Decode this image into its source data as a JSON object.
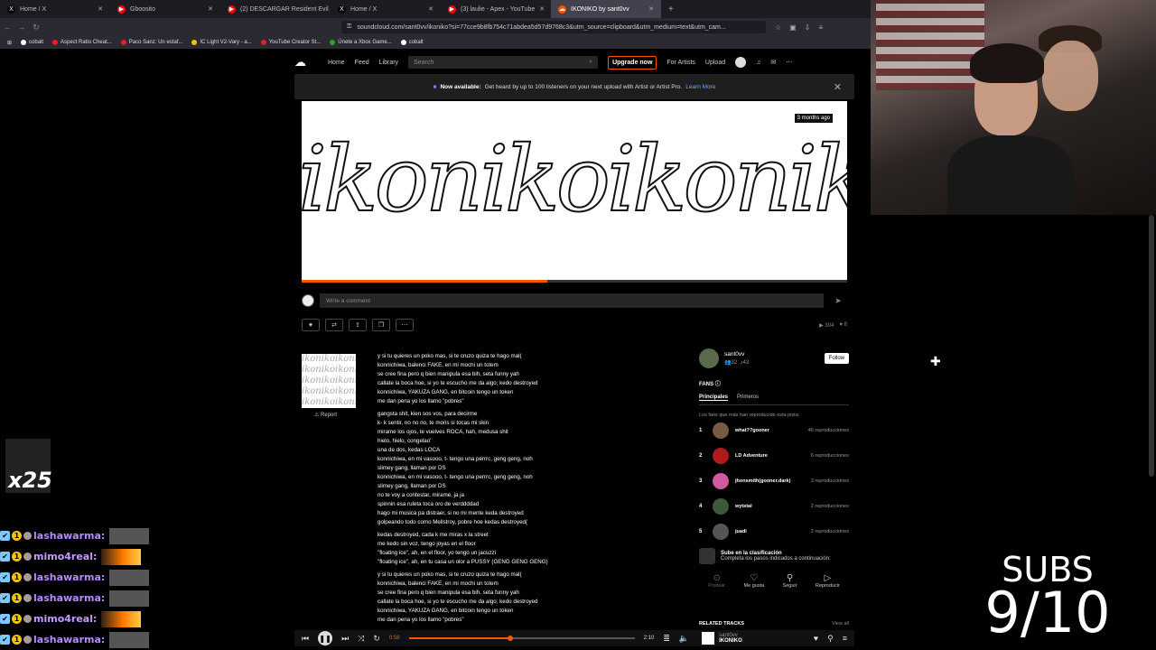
{
  "browser": {
    "tabs": [
      {
        "title": "Home / X",
        "icon": "x-icon",
        "color": "#000000",
        "active": false
      },
      {
        "title": "Gboosito",
        "icon": "youtube-icon",
        "color": "#ff0000",
        "active": false
      },
      {
        "title": "(2) DESCARGAR Resident Evil 4 Ultim",
        "icon": "youtube-icon",
        "color": "#ff0000",
        "active": false
      },
      {
        "title": "Home / X",
        "icon": "x-icon",
        "color": "#000000",
        "active": false
      },
      {
        "title": "(3) laulie - Apex - YouTube",
        "icon": "youtube-icon",
        "color": "#ff0000",
        "active": false
      },
      {
        "title": "IKONIKO by sant0vv",
        "icon": "soundcloud-icon",
        "color": "#ff5500",
        "active": true
      }
    ],
    "new_tab": "+",
    "url": "soundcloud.com/sant0vv/ikoniko?si=77cce9b8fb754c71abdea5d57d9768c3&utm_source=clipboard&utm_medium=text&utm_cam...",
    "bookmarks": [
      "cobalt",
      "Aspect Ratio Cheat...",
      "Paco Sanz: Un estaf...",
      "IC Light V2-Vary - a...",
      "YouTube Creator St...",
      "Únete a Xbox Game...",
      "cobalt"
    ]
  },
  "soundcloud": {
    "nav": [
      "Home",
      "Feed",
      "Library"
    ],
    "search_placeholder": "Search",
    "upgrade": "Upgrade now",
    "for_artists": "For Artists",
    "upload": "Upload",
    "banner_bold": "Now available:",
    "banner_text": "Get heard by up to 100 listeners on your next upload with Artist or Artist Pro.",
    "banner_link": "Learn More",
    "artwork_text": "ikonikoikonikoikoniko",
    "posted": "3 months ago",
    "progress_fraction": 0.45,
    "comment_placeholder": "Write a comment",
    "plays": "304",
    "likes": "8",
    "report": "Report",
    "lyrics": [
      "y si tu quieres un poko mas, si te cruzo quiza te hago mal(",
      "konnichiwa, balenci FAKE, en mi mochi un totem",
      "se cree fina pero q bien manipula esa bih, seta funny yah",
      "callate la boca hoe, si yo te escucho me da algo; kedo destroyed",
      "konnichiwa, YAKUZA GANG, en bitcoin tengo un token",
      "me dan pena yo los llamo \"pobres\"",
      "",
      "gangsta shit, kien sos vos, para decirme",
      "k- k sentir, no no no, te moris si tocas mi skin",
      "mirame los ojos, te vuelves ROCA, hah, medusa shit",
      "hielo, hielo, congelao'",
      "una de dos, kedas LOCA",
      "konnichiwa, en mi vasooo, t- tengo una perrrc, geng geng, noh",
      "slimey gang, llaman por DS",
      "konnichiwa, en mi vasooo, t- tengo una perrrc, geng geng, noh",
      "slimey gang, llaman por DS",
      "no te voy a contestar, mirame, ja ja",
      "spinnin esa ruleta toca oro de verddddad",
      "hago mi musica pa distraer, si no mi mente keda destroyed",
      "golpeando todo como Mellstroy, pobre hoe kedas destroyed(",
      "",
      "kedas destroyed, cada k me miras x la street",
      "me kedo sin voz, tengo joyas en el floor",
      "\"floating ice\", ah, en el floor, yo tengo un jacuzzi",
      "\"floating ice\", ah, en tu casa un olor a PUSSY (GENG GENG GENG)",
      "",
      "y si tu quieres un poko mas, si te cruzo quiza te hago mal(",
      "konnichiwa, balenci FAKE, en mi mochi un totem",
      "se cree fina pero q bien manipula esa bih, seta funny yah",
      "callate la boca hoe, si yo te escucho me da algo; kedo destroyed",
      "konnichiwa, YAKUZA GANG, en bitcoin tengo un token",
      "me dan pena yo los llamo \"pobres\""
    ],
    "artist": {
      "name": "sant0vv",
      "followers": "32",
      "tracks": "43",
      "follow": "Follow"
    },
    "fans_title": "FANS",
    "fans_tabs": [
      "Principales",
      "Primeros"
    ],
    "fans_desc": "Los fans que más han reproducido esta pista:",
    "fans": [
      {
        "rank": "1",
        "name": "what??gooner",
        "count": "46 reproducciones",
        "color": "#7a5a40"
      },
      {
        "rank": "2",
        "name": "LD Adventure",
        "count": "6 reproducciones",
        "color": "#b01a1a"
      },
      {
        "rank": "3",
        "name": "jhonsmith(gooner.dark)",
        "count": "3 reproducciones",
        "color": "#d05aa0"
      },
      {
        "rank": "4",
        "name": "wytstal",
        "count": "2 reproducciones",
        "color": "#3a5a3a"
      },
      {
        "rank": "5",
        "name": "juadi",
        "count": "2 reproducciones",
        "color": "#555555"
      }
    ],
    "rank_title": "Sube en la clasificación",
    "rank_desc": "Completa los pasos indicados a continuación:",
    "rank_actions": [
      "Postear",
      "Me gusta",
      "Seguir",
      "Reproducir"
    ],
    "related": "RELATED TRACKS",
    "view_all": "View all",
    "player": {
      "elapsed": "0:58",
      "total": "2:10",
      "artist": "sant0vv",
      "title": "IKONIKO",
      "progress_fraction": 0.45
    }
  },
  "stream": {
    "multiplier": "x25",
    "chat": [
      {
        "user": "lashawarma:",
        "emote": "gray"
      },
      {
        "user": "mimo4real:",
        "emote": "fire"
      },
      {
        "user": "lashawarma:",
        "emote": "gray"
      },
      {
        "user": "lashawarma:",
        "emote": "gray"
      },
      {
        "user": "mimo4real:",
        "emote": "fire"
      },
      {
        "user": "lashawarma:",
        "emote": "gray"
      }
    ],
    "subs_label": "SUBS",
    "subs_count": "9/10"
  }
}
